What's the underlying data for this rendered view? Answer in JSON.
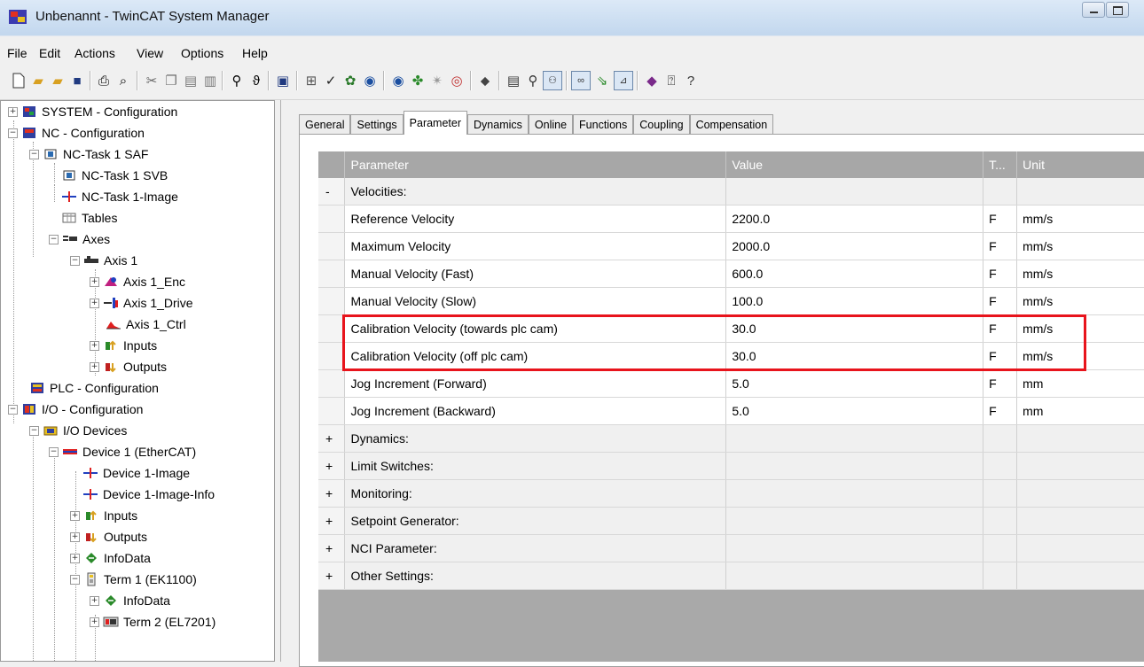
{
  "window": {
    "title": "Unbenannt - TwinCAT System Manager"
  },
  "menu": [
    "File",
    "Edit",
    "Actions",
    "View",
    "Options",
    "Help"
  ],
  "tree": {
    "items": [
      {
        "label": "SYSTEM - Configuration"
      },
      {
        "label": "NC - Configuration"
      },
      {
        "label": "NC-Task 1 SAF"
      },
      {
        "label": "NC-Task 1 SVB"
      },
      {
        "label": "NC-Task 1-Image"
      },
      {
        "label": "Tables"
      },
      {
        "label": "Axes"
      },
      {
        "label": "Axis 1"
      },
      {
        "label": "Axis 1_Enc"
      },
      {
        "label": "Axis 1_Drive"
      },
      {
        "label": "Axis 1_Ctrl"
      },
      {
        "label": "Inputs"
      },
      {
        "label": "Outputs"
      },
      {
        "label": "PLC - Configuration"
      },
      {
        "label": "I/O - Configuration"
      },
      {
        "label": "I/O Devices"
      },
      {
        "label": "Device 1 (EtherCAT)"
      },
      {
        "label": "Device 1-Image"
      },
      {
        "label": "Device 1-Image-Info"
      },
      {
        "label": "Inputs"
      },
      {
        "label": "Outputs"
      },
      {
        "label": "InfoData"
      },
      {
        "label": "Term 1 (EK1100)"
      },
      {
        "label": "InfoData"
      },
      {
        "label": "Term 2 (EL7201)"
      }
    ]
  },
  "tabs": [
    "General",
    "Settings",
    "Parameter",
    "Dynamics",
    "Online",
    "Functions",
    "Coupling",
    "Compensation"
  ],
  "active_tab": "Parameter",
  "table": {
    "headers": [
      "Parameter",
      "Value",
      "T...",
      "Unit"
    ],
    "rows": [
      {
        "gutter": "-",
        "parameter": "Velocities:",
        "value": "",
        "type": "",
        "unit": "",
        "group": true
      },
      {
        "gutter": "",
        "parameter": "Reference Velocity",
        "value": "2200.0",
        "type": "F",
        "unit": "mm/s"
      },
      {
        "gutter": "",
        "parameter": "Maximum Velocity",
        "value": "2000.0",
        "type": "F",
        "unit": "mm/s"
      },
      {
        "gutter": "",
        "parameter": "Manual Velocity (Fast)",
        "value": "600.0",
        "type": "F",
        "unit": "mm/s"
      },
      {
        "gutter": "",
        "parameter": "Manual Velocity (Slow)",
        "value": "100.0",
        "type": "F",
        "unit": "mm/s"
      },
      {
        "gutter": "",
        "parameter": "Calibration Velocity (towards plc cam)",
        "value": "30.0",
        "type": "F",
        "unit": "mm/s"
      },
      {
        "gutter": "",
        "parameter": "Calibration Velocity (off plc cam)",
        "value": "30.0",
        "type": "F",
        "unit": "mm/s"
      },
      {
        "gutter": "",
        "parameter": "Jog Increment (Forward)",
        "value": "5.0",
        "type": "F",
        "unit": "mm"
      },
      {
        "gutter": "",
        "parameter": "Jog Increment (Backward)",
        "value": "5.0",
        "type": "F",
        "unit": "mm"
      },
      {
        "gutter": "+",
        "parameter": "Dynamics:",
        "value": "",
        "type": "",
        "unit": "",
        "group": true
      },
      {
        "gutter": "+",
        "parameter": "Limit Switches:",
        "value": "",
        "type": "",
        "unit": "",
        "group": true
      },
      {
        "gutter": "+",
        "parameter": "Monitoring:",
        "value": "",
        "type": "",
        "unit": "",
        "group": true
      },
      {
        "gutter": "+",
        "parameter": "Setpoint Generator:",
        "value": "",
        "type": "",
        "unit": "",
        "group": true
      },
      {
        "gutter": "+",
        "parameter": "NCI Parameter:",
        "value": "",
        "type": "",
        "unit": "",
        "group": true
      },
      {
        "gutter": "+",
        "parameter": "Other Settings:",
        "value": "",
        "type": "",
        "unit": "",
        "group": true
      }
    ]
  },
  "colors": {
    "highlight": "#e8141c",
    "grid_header": "#a7a7a7",
    "grid_empty": "#a9a9a9"
  }
}
